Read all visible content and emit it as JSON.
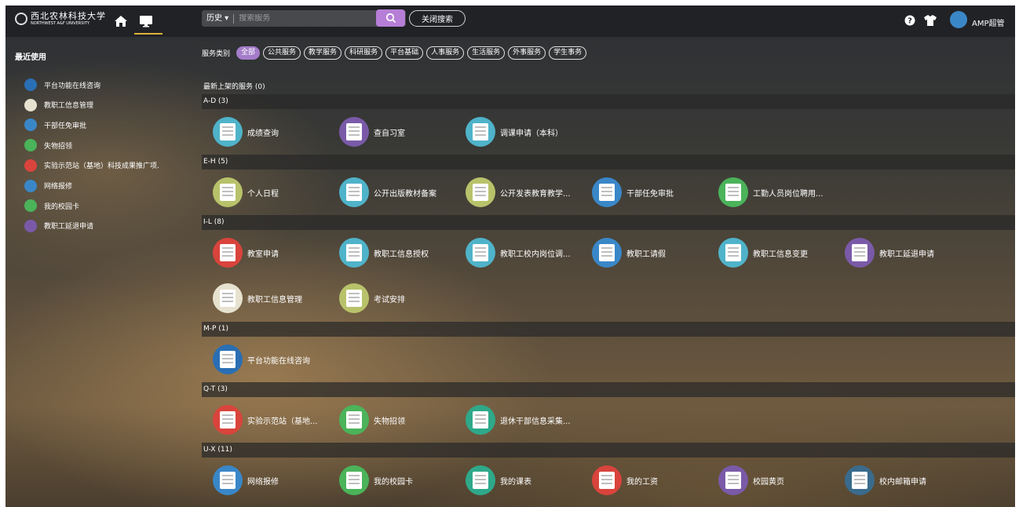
{
  "header": {
    "school_name_cn": "西北农林科技大学",
    "school_name_en": "NORTHWEST A&F UNIVERSITY",
    "history_label": "历史 ▾",
    "search_placeholder": "搜索服务",
    "close_search_label": "关闭搜索",
    "user_name": "AMP超管",
    "accent_color": "#b67ed6",
    "icons": [
      "home-icon",
      "desktop-icon",
      "search-icon",
      "help-icon",
      "shirt-icon"
    ]
  },
  "sidebar": {
    "title": "最近使用",
    "items": [
      {
        "label": "平台功能在线咨询",
        "color": "#2a6fb3",
        "icon": "chat-icon"
      },
      {
        "label": "教职工信息管理",
        "color": "#e6e2cf",
        "icon": "profile-icon"
      },
      {
        "label": "干部任免审批",
        "color": "#3a87c8",
        "icon": "person-icon"
      },
      {
        "label": "失物招领",
        "color": "#4bb35a",
        "icon": "lost-found-icon"
      },
      {
        "label": "实验示范站（基地）科技成果推广项.",
        "color": "#d9443c",
        "icon": "microscope-icon"
      },
      {
        "label": "网络报修",
        "color": "#3a87c8",
        "icon": "network-icon"
      },
      {
        "label": "我的校园卡",
        "color": "#4bb35a",
        "icon": "card-icon"
      },
      {
        "label": "教职工延退申请",
        "color": "#7a5aa8",
        "icon": "person-icon"
      }
    ]
  },
  "main": {
    "category_label": "服务类别",
    "categories": [
      {
        "label": "全部",
        "active": true
      },
      {
        "label": "公共服务",
        "active": false
      },
      {
        "label": "教学服务",
        "active": false
      },
      {
        "label": "科研服务",
        "active": false
      },
      {
        "label": "平台基础",
        "active": false
      },
      {
        "label": "人事服务",
        "active": false
      },
      {
        "label": "生活服务",
        "active": false
      },
      {
        "label": "外事服务",
        "active": false
      },
      {
        "label": "学生事务",
        "active": false
      }
    ],
    "new_services_title": "最新上架的服务 (0)",
    "groups": [
      {
        "title": "A-D (3)",
        "rows": [
          [
            {
              "label": "成绩查询",
              "color": "#4fb3c9"
            },
            {
              "label": "查自习室",
              "color": "#7a5aa8"
            },
            {
              "label": "调课申请（本科）",
              "color": "#4fb3c9"
            }
          ]
        ]
      },
      {
        "title": "E-H (5)",
        "rows": [
          [
            {
              "label": "个人日程",
              "color": "#b8c26a"
            },
            {
              "label": "公开出版教材备案",
              "color": "#4fb3c9"
            },
            {
              "label": "公开发表教育教学...",
              "color": "#b8c26a"
            },
            {
              "label": "干部任免审批",
              "color": "#3a87c8"
            },
            {
              "label": "工勤人员岗位聘用...",
              "color": "#4bb35a"
            }
          ]
        ]
      },
      {
        "title": "I-L (8)",
        "rows": [
          [
            {
              "label": "教室申请",
              "color": "#d9443c"
            },
            {
              "label": "教职工信息授权",
              "color": "#4fb3c9"
            },
            {
              "label": "教职工校内岗位调...",
              "color": "#4fb3c9"
            },
            {
              "label": "教职工请假",
              "color": "#3a87c8"
            },
            {
              "label": "教职工信息变更",
              "color": "#4fb3c9"
            },
            {
              "label": "教职工延退申请",
              "color": "#7a5aa8"
            }
          ],
          [
            {
              "label": "教职工信息管理",
              "color": "#e6e2cf"
            },
            {
              "label": "考试安排",
              "color": "#b8c26a"
            }
          ]
        ]
      },
      {
        "title": "M-P (1)",
        "rows": [
          [
            {
              "label": "平台功能在线咨询",
              "color": "#2a6fb3"
            }
          ]
        ]
      },
      {
        "title": "Q-T (3)",
        "rows": [
          [
            {
              "label": "实验示范站（基地...",
              "color": "#d9443c"
            },
            {
              "label": "失物招领",
              "color": "#4bb35a"
            },
            {
              "label": "退休干部信息采集...",
              "color": "#2fa88a"
            }
          ]
        ]
      },
      {
        "title": "U-X (11)",
        "rows": [
          [
            {
              "label": "网络报修",
              "color": "#3a87c8"
            },
            {
              "label": "我的校园卡",
              "color": "#4bb35a"
            },
            {
              "label": "我的课表",
              "color": "#2fa88a"
            },
            {
              "label": "我的工资",
              "color": "#d9443c"
            },
            {
              "label": "校园黄页",
              "color": "#7a5aa8"
            },
            {
              "label": "校内邮箱申请",
              "color": "#3a6b8c"
            }
          ]
        ]
      }
    ]
  }
}
